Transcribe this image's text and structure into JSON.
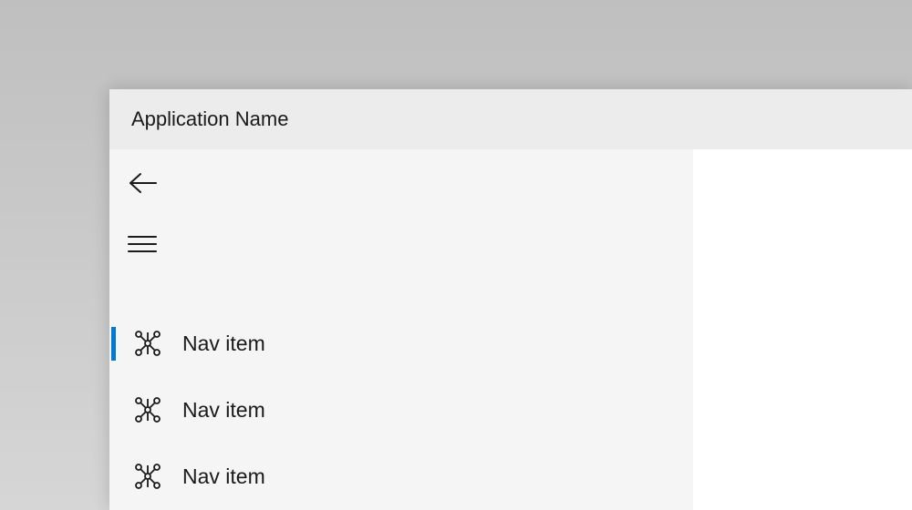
{
  "colors": {
    "accent": "#0078d7",
    "titlebar": "#ececec",
    "navpane": "#f5f5f5",
    "content": "#ffffff"
  },
  "window": {
    "title": "Application Name"
  },
  "nav": {
    "back_icon": "back-arrow-icon",
    "menu_icon": "hamburger-icon",
    "items": [
      {
        "label": "Nav item",
        "icon": "graph-icon",
        "selected": true
      },
      {
        "label": "Nav item",
        "icon": "graph-icon",
        "selected": false
      },
      {
        "label": "Nav item",
        "icon": "graph-icon",
        "selected": false
      }
    ]
  }
}
